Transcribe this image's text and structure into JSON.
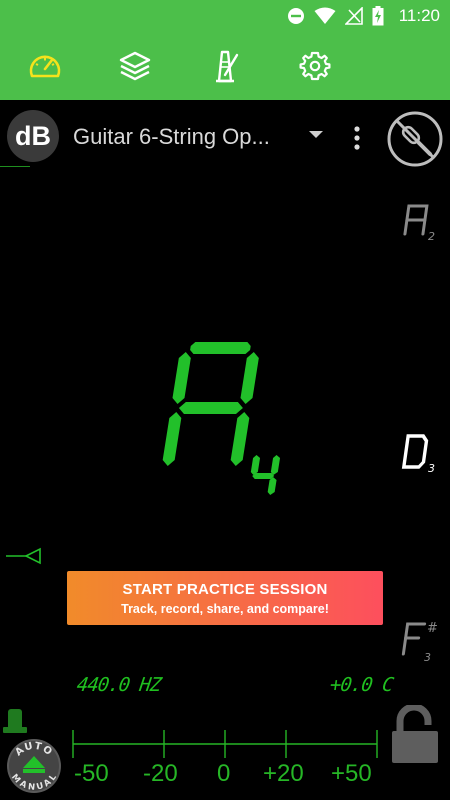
{
  "status_bar": {
    "time": "11:20"
  },
  "toolbar": {
    "items": [
      {
        "name": "tuner"
      },
      {
        "name": "layers"
      },
      {
        "name": "metronome"
      },
      {
        "name": "settings"
      }
    ],
    "accent": "#4cbf4a"
  },
  "header": {
    "db_label": "dB",
    "tuning_name": "Guitar 6-String Op..."
  },
  "notes": {
    "main": {
      "letter": "A",
      "octave": "4",
      "color": "#22c02a"
    },
    "upper": {
      "letter": "A",
      "octave": "2"
    },
    "middle": {
      "letter": "D",
      "octave": "3"
    },
    "lower": {
      "letter": "F",
      "accidental": "#",
      "octave": "3"
    }
  },
  "practice": {
    "title": "START PRACTICE SESSION",
    "subtitle": "Track, record, share, and compare!"
  },
  "readouts": {
    "frequency": "440.0 HZ",
    "cents": "+0.0 C"
  },
  "scale": {
    "labels": [
      "-50",
      "-20",
      "0",
      "+20",
      "+50"
    ]
  },
  "mode_knob": {
    "top": "AUTO",
    "bottom": "MANUAL"
  }
}
